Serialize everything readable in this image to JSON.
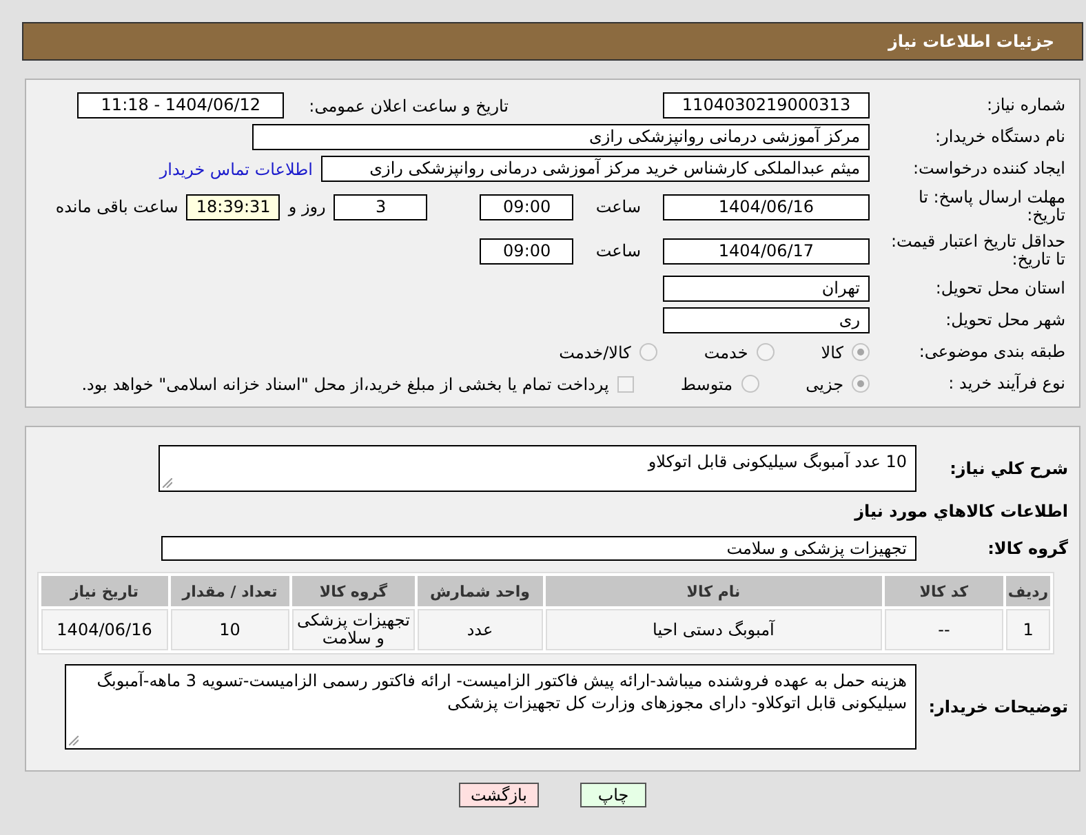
{
  "title": "جزئیات اطلاعات نیاز",
  "need_number": {
    "label": "شماره نیاز:",
    "value": "1104030219000313"
  },
  "announce": {
    "label": "تاریخ و ساعت اعلان عمومی:",
    "value": "1404/06/12 - 11:18"
  },
  "buyer_org": {
    "label": "نام دستگاه خریدار:",
    "value": "مرکز آموزشی درمانی روانپزشکی رازی"
  },
  "requester": {
    "label": "ایجاد کننده درخواست:",
    "value": "میثم عبدالملکی کارشناس خرید مرکز آموزشی درمانی روانپزشکی رازی",
    "link": "اطلاعات تماس خریدار"
  },
  "reply_deadline": {
    "label": "مهلت ارسال پاسخ: تا تاریخ:",
    "date": "1404/06/16",
    "time_label": "ساعت",
    "time": "09:00",
    "days": "3",
    "days_label": "روز و",
    "remaining": "18:39:31",
    "remaining_label": "ساعت باقی مانده"
  },
  "price_validity": {
    "label": "حداقل تاریخ اعتبار قیمت: تا تاریخ:",
    "date": "1404/06/17",
    "time_label": "ساعت",
    "time": "09:00"
  },
  "province": {
    "label": "استان محل تحویل:",
    "value": "تهران"
  },
  "city": {
    "label": "شهر محل تحویل:",
    "value": "ری"
  },
  "category": {
    "label": "طبقه بندی موضوعی:",
    "options": [
      {
        "label": "کالا",
        "selected": true
      },
      {
        "label": "خدمت",
        "selected": false
      },
      {
        "label": "کالا/خدمت",
        "selected": false
      }
    ]
  },
  "purchase_process": {
    "label": "نوع فرآیند خرید :",
    "options": [
      {
        "label": "جزیی",
        "selected": true
      },
      {
        "label": "متوسط",
        "selected": false
      }
    ],
    "payment": {
      "label": "پرداخت تمام یا بخشی از مبلغ خرید،از محل \"اسناد خزانه اسلامی\" خواهد بود.",
      "checked": false
    }
  },
  "description": {
    "label": "شرح کلي نياز:",
    "value": "10 عدد آمبوبگ سیلیکونی قابل اتوکلاو"
  },
  "goods_heading": "اطلاعات کالاهاي مورد نياز",
  "goods_group": {
    "label": "گروه کالا:",
    "value": "تجهیزات پزشکی و سلامت"
  },
  "table": {
    "columns": [
      "ردیف",
      "کد کالا",
      "نام کالا",
      "واحد شمارش",
      "گروه کالا",
      "تعداد / مقدار",
      "تاریخ نیاز"
    ],
    "rows": [
      [
        "1",
        "--",
        "آمبوبگ دستی احیا",
        "عدد",
        "تجهیزات پزشکی و سلامت",
        "10",
        "1404/06/16"
      ]
    ]
  },
  "buyer_notes": {
    "label": "توضیحات خریدار:",
    "value": "هزینه حمل به عهده فروشنده میباشد-ارائه پیش فاکتور الزامیست- ارائه فاکتور رسمی الزامیست-تسویه 3 ماهه-آمبوبگ سیلیکونی قابل اتوکلاو- دارای مجوزهای وزارت کل تجهیزات پزشکی"
  },
  "buttons": [
    {
      "label": "چاپ",
      "kind": "print"
    },
    {
      "label": "بازگشت",
      "kind": "back"
    }
  ]
}
